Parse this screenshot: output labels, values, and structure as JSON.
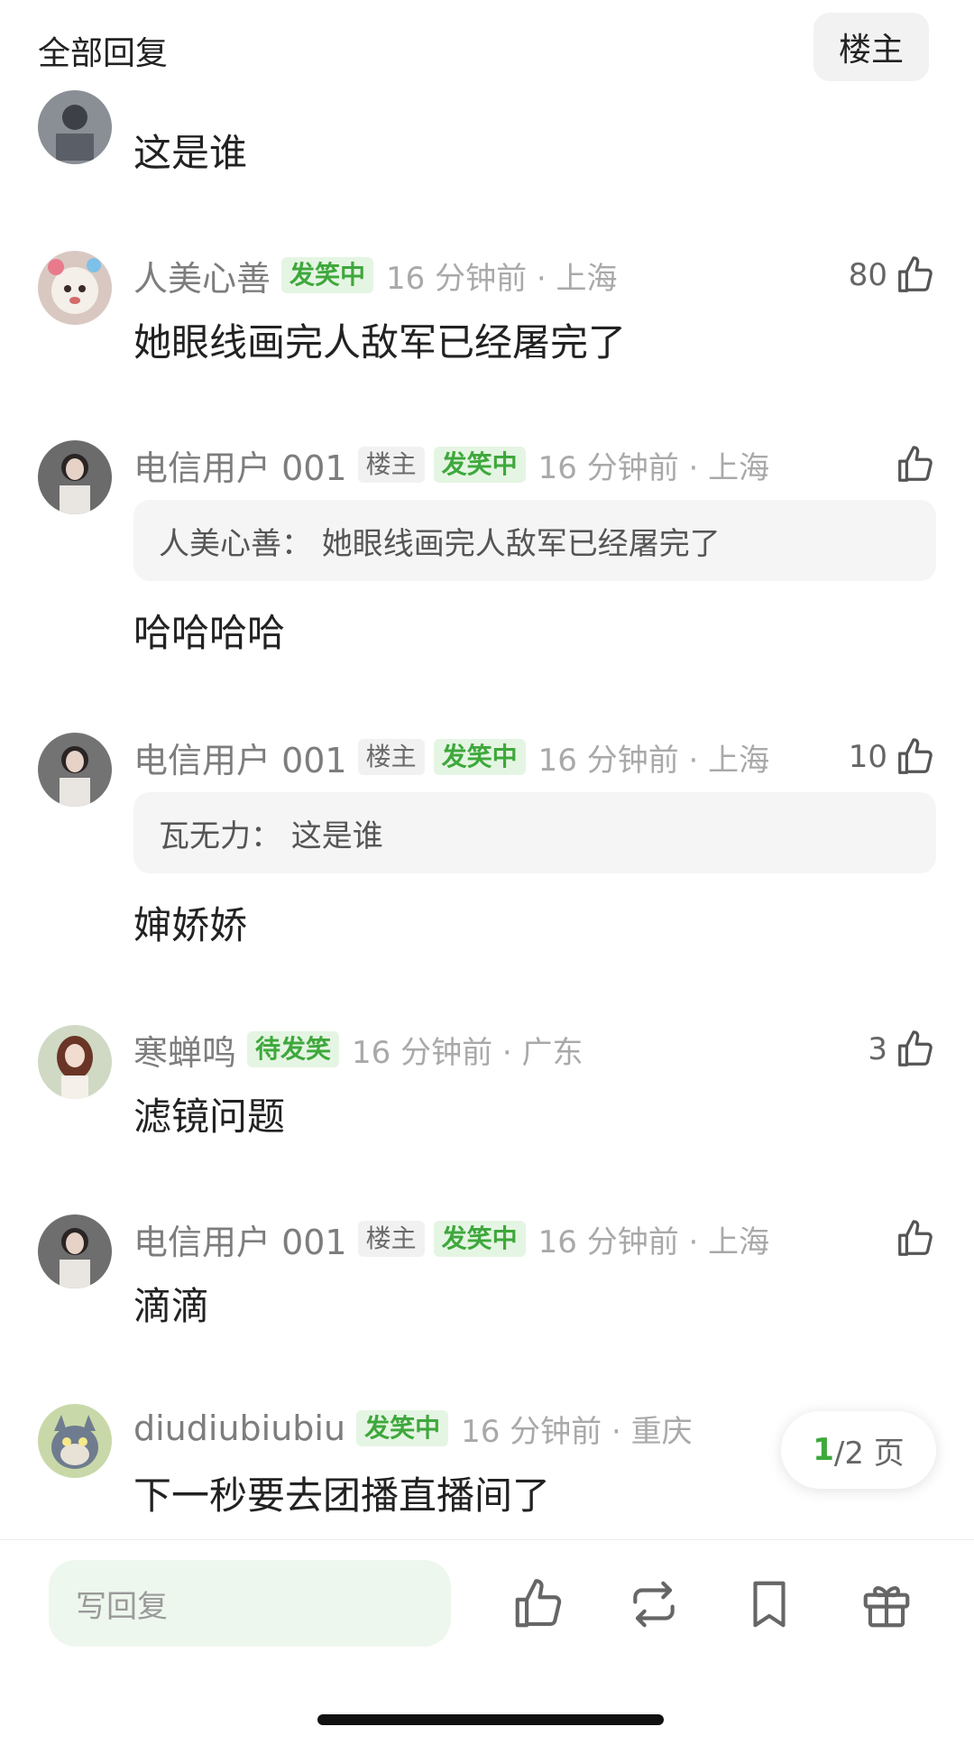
{
  "header": {
    "title": "全部回复",
    "owner_filter": "楼主"
  },
  "comments": [
    {
      "text": "这是谁"
    },
    {
      "username": "人美心善",
      "tag": "发笑中",
      "time": "16 分钟前 · 上海",
      "likes": "80",
      "text": "她眼线画完人敌军已经屠完了"
    },
    {
      "username": "电信用户 001",
      "owner_tag": "楼主",
      "tag": "发笑中",
      "time": "16 分钟前 · 上海",
      "likes": "",
      "quote": "人美心善： 她眼线画完人敌军已经屠完了",
      "text": "哈哈哈哈"
    },
    {
      "username": "电信用户 001",
      "owner_tag": "楼主",
      "tag": "发笑中",
      "time": "16 分钟前 · 上海",
      "likes": "10",
      "quote": "瓦无力： 这是谁",
      "text": "婶娇娇"
    },
    {
      "username": "寒蝉鸣",
      "tag": "待发笑",
      "time": "16 分钟前 · 广东",
      "likes": "3",
      "text": "滤镜问题"
    },
    {
      "username": "电信用户 001",
      "owner_tag": "楼主",
      "tag": "发笑中",
      "time": "16 分钟前 · 上海",
      "likes": "",
      "text": "滴滴"
    },
    {
      "username": "diudiubiubiu",
      "tag": "发笑中",
      "time": "16 分钟前 · 重庆",
      "text": "下一秒要去团播直播间了"
    }
  ],
  "pager": {
    "current": "1",
    "total": "/2 页"
  },
  "bottom_bar": {
    "reply_placeholder": "写回复",
    "icons": [
      "thumbs-up-icon",
      "repost-icon",
      "bookmark-icon",
      "gift-icon"
    ]
  },
  "colors": {
    "accent_green": "#3ea83c",
    "tag_green_bg": "#e5f5e3",
    "quote_bg": "#f5f5f5"
  }
}
